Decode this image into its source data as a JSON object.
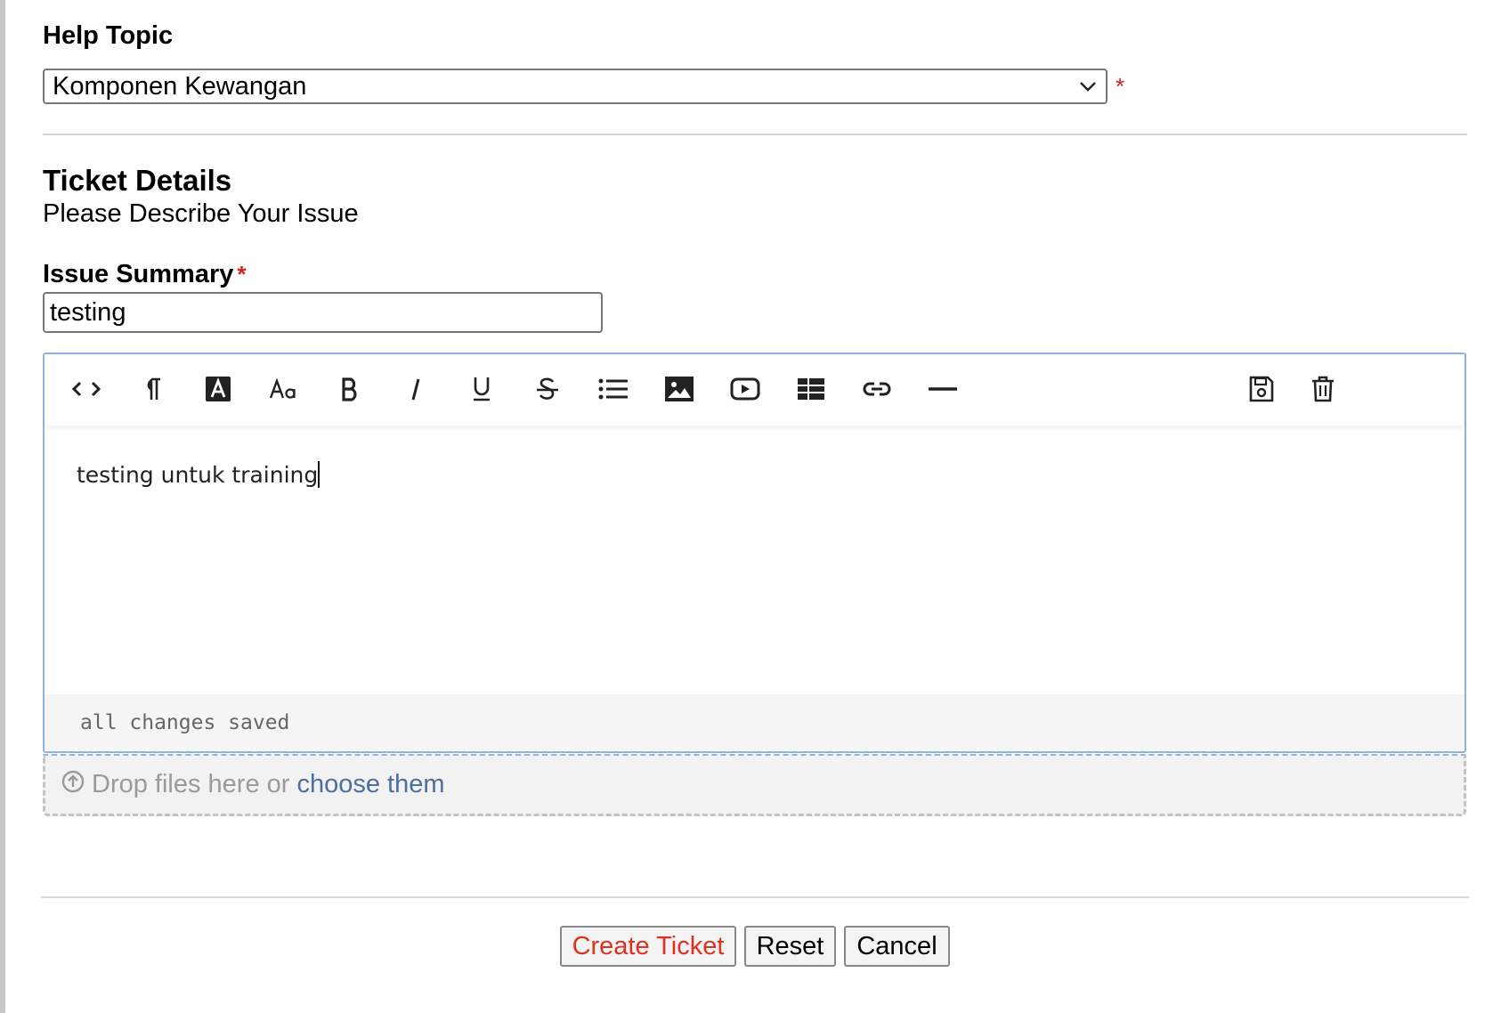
{
  "help_topic": {
    "label": "Help Topic",
    "selected": "Komponen Kewangan",
    "required_mark": "*"
  },
  "ticket_details": {
    "title": "Ticket Details",
    "subtitle": "Please Describe Your Issue"
  },
  "issue_summary": {
    "label": "Issue Summary",
    "required_mark": "*",
    "value": "testing"
  },
  "editor": {
    "toolbar": [
      {
        "name": "code-view-icon"
      },
      {
        "name": "paragraph-format-icon"
      },
      {
        "name": "text-color-icon"
      },
      {
        "name": "font-size-icon"
      },
      {
        "name": "bold-icon"
      },
      {
        "name": "italic-icon"
      },
      {
        "name": "underline-icon"
      },
      {
        "name": "strikethrough-icon"
      },
      {
        "name": "unordered-list-icon"
      },
      {
        "name": "insert-image-icon"
      },
      {
        "name": "insert-video-icon"
      },
      {
        "name": "insert-table-icon"
      },
      {
        "name": "insert-link-icon"
      },
      {
        "name": "horizontal-rule-icon"
      },
      {
        "name": "save-draft-icon"
      },
      {
        "name": "delete-draft-icon"
      }
    ],
    "content": "testing untuk training",
    "status": "all changes saved"
  },
  "attachments": {
    "prompt": "Drop files here or",
    "link": "choose them"
  },
  "buttons": {
    "create": "Create Ticket",
    "reset": "Reset",
    "cancel": "Cancel"
  },
  "colors": {
    "required": "#d12222",
    "create_text": "#e0301e",
    "link": "#4a6fa0",
    "editor_border": "#8fb4e0"
  }
}
